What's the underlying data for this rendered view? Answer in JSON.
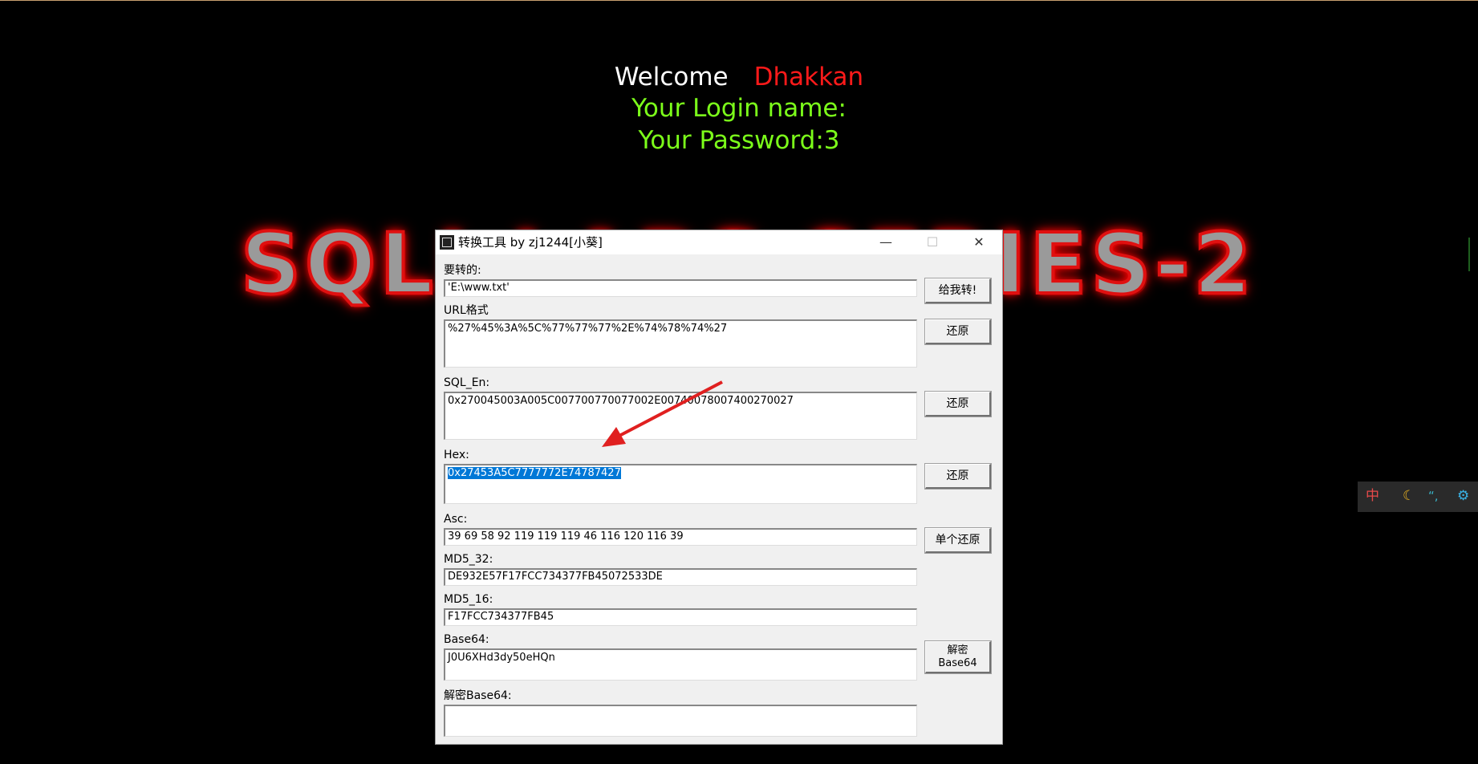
{
  "welcome": {
    "greeting": "Welcome",
    "username": "Dhakkan",
    "login_line": "Your Login name:",
    "password_line": "Your Password:3"
  },
  "banner_text": "SQLI-LABS SERIES-2",
  "dialog": {
    "title": "转换工具 by zj1244[小葵]",
    "minimize": "—",
    "maximize": "☐",
    "close": "✕",
    "input_label": "要转的:",
    "input_value": "'E:\\www.txt'",
    "convert_button": "给我转!",
    "url_label": "URL格式",
    "url_value": "%27%45%3A%5C%77%77%77%2E%74%78%74%27",
    "url_restore": "还原",
    "sqlen_label": "SQL_En:",
    "sqlen_value": "0x270045003A005C007700770077002E00740078007400270027",
    "sqlen_restore": "还原",
    "hex_label": "Hex:",
    "hex_value": "0x27453A5C7777772E74787427",
    "hex_restore": "还原",
    "asc_label": "Asc:",
    "asc_value": "39 69 58 92 119 119 119 46 116 120 116 39",
    "asc_restore": "单个还原",
    "md5_32_label": "MD5_32:",
    "md5_32_value": "DE932E57F17FCC734377FB45072533DE",
    "md5_16_label": "MD5_16:",
    "md5_16_value": "F17FCC734377FB45",
    "base64_label": "Base64:",
    "base64_value": "J0U6XHd3dy50eHQn",
    "decode_line1": "解密",
    "decode_line2": "Base64",
    "decoded_label": "解密Base64:",
    "decoded_value": ""
  },
  "tray": {
    "ime": "中",
    "moon_icon": "moon-icon",
    "punct": "“,",
    "settings_icon": "gear-icon"
  },
  "colors": {
    "accent_red": "#ff1a1a",
    "lime": "#7cff1a",
    "selection": "#0078d7"
  }
}
